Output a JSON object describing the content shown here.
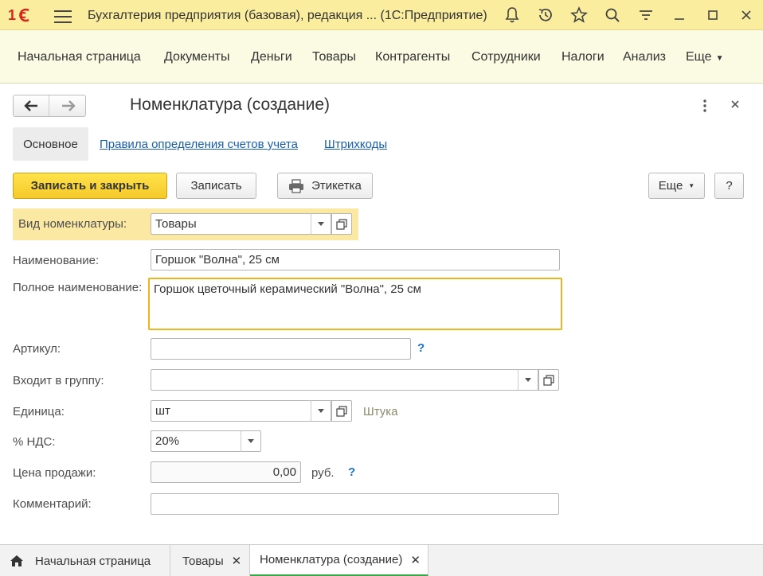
{
  "titlebar": {
    "app_title": "Бухгалтерия предприятия (базовая), редакция ...   (1С:Предприятие)",
    "icons": [
      "bell-icon",
      "history-icon",
      "star-icon",
      "search-icon",
      "filter-icon",
      "minimize-icon",
      "maximize-icon",
      "close-icon"
    ]
  },
  "sections": {
    "items": [
      "Начальная страница",
      "Документы",
      "Деньги",
      "Товары",
      "Контрагенты",
      "Сотрудники",
      "Налоги",
      "Анализ",
      "Еще"
    ]
  },
  "form": {
    "title": "Номенклатура (создание)",
    "tabs": {
      "active": "Основное",
      "links": [
        "Правила определения счетов учета",
        "Штрихкоды"
      ]
    },
    "buttons": {
      "save_close": "Записать и закрыть",
      "save": "Записать",
      "label": "Этикетка",
      "more": "Еще",
      "help": "?"
    },
    "fields": {
      "vid": {
        "label": "Вид номенклатуры:",
        "value": "Товары"
      },
      "name": {
        "label": "Наименование:",
        "value": "Горшок \"Волна\", 25 см"
      },
      "full_name": {
        "label": "Полное наименование:",
        "value": "Горшок цветочный керамический \"Волна\", 25 см"
      },
      "article": {
        "label": "Артикул:",
        "value": "",
        "help": "?"
      },
      "group": {
        "label": "Входит в группу:",
        "value": ""
      },
      "unit": {
        "label": "Единица:",
        "value": "шт",
        "hint": "Штука"
      },
      "vat": {
        "label": "% НДС:",
        "value": "20%"
      },
      "price": {
        "label": "Цена продажи:",
        "value": "0,00",
        "currency": "руб.",
        "help": "?"
      },
      "comment": {
        "label": "Комментарий:",
        "value": ""
      }
    }
  },
  "bottom_tabs": [
    {
      "label": "Начальная страница",
      "active": false
    },
    {
      "label": "Товары",
      "active": false
    },
    {
      "label": "Номенклатура (создание)",
      "active": true
    }
  ],
  "colors": {
    "accent_yellow": "#fbed9e",
    "primary_button": "#f5c92a",
    "link": "#1a5ea8",
    "active_tab_underline": "#3aa64a"
  }
}
